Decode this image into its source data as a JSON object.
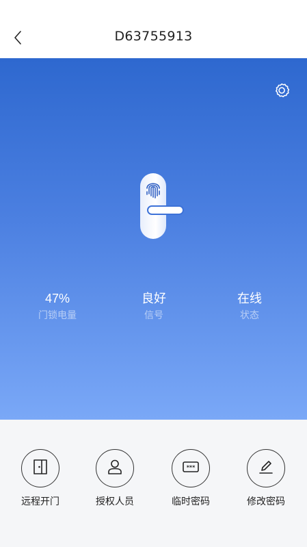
{
  "header": {
    "title": "D63755913",
    "back_icon": "chevron-left-icon"
  },
  "hero": {
    "settings_icon": "gear-icon",
    "lock_icon": "fingerprint-door-lock-icon",
    "colors": {
      "gradient_top": "#2e68cf",
      "gradient_bottom": "#7aa8f7"
    }
  },
  "stats": [
    {
      "value": "47%",
      "label": "门锁电量"
    },
    {
      "value": "良好",
      "label": "信号"
    },
    {
      "value": "在线",
      "label": "状态"
    }
  ],
  "actions": [
    {
      "label": "远程开门",
      "icon": "door-open-icon"
    },
    {
      "label": "授权人员",
      "icon": "user-icon"
    },
    {
      "label": "临时密码",
      "icon": "password-icon"
    },
    {
      "label": "修改密码",
      "icon": "edit-icon"
    }
  ]
}
